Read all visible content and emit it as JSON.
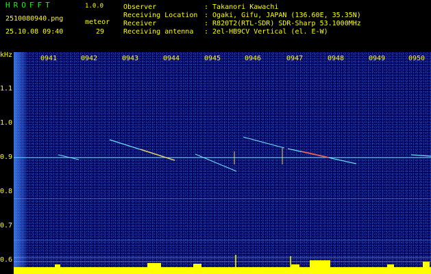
{
  "header": {
    "app_name": "HROFFT",
    "version": "1.0.0",
    "filename": "2510080940.png",
    "timestamp": "25.10.08 09:40",
    "meteor_label": "meteor",
    "meteor_count": "29",
    "info": [
      {
        "key": "Observer",
        "value": ": Takanori Kawachi"
      },
      {
        "key": "Receiving Location",
        "value": ": Ogaki, Gifu, JAPAN (136.60E, 35.35N)"
      },
      {
        "key": "Receiver",
        "value": ": R820T2(RTL-SDR) SDR-Sharp 53.1000MHz"
      },
      {
        "key": "Receiving antenna",
        "value": ": 2el-HB9CV Vertical (el. E-W)"
      }
    ]
  },
  "spectrogram": {
    "y_unit": "kHz",
    "y_ticks": [
      "1.1",
      "1.0",
      "0.9",
      "0.8",
      "0.7",
      "0.6"
    ],
    "x_ticks": [
      "0941",
      "0942",
      "0943",
      "0944",
      "0945",
      "0946",
      "0947",
      "0948",
      "0949",
      "0950"
    ],
    "colors": {
      "background": "#04045a",
      "axis_text": "#ffff00",
      "power_bar": "#ffff00",
      "carrier": "#5fd0ff"
    }
  }
}
